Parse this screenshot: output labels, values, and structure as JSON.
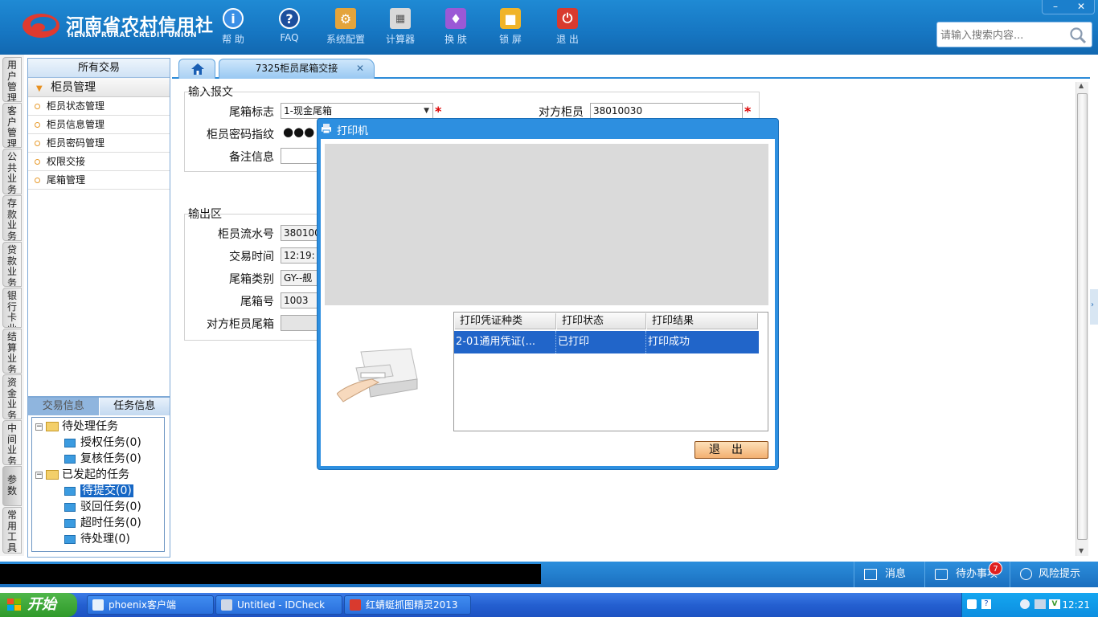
{
  "header": {
    "logo_cn": "河南省农村信用社",
    "logo_en": "HENAN RURAL CREDIT UNION",
    "toolbar": [
      {
        "label": "帮 助",
        "icon": "help-icon"
      },
      {
        "label": "FAQ",
        "icon": "faq-icon"
      },
      {
        "label": "系统配置",
        "icon": "settings-icon"
      },
      {
        "label": "计算器",
        "icon": "calculator-icon"
      },
      {
        "label": "换 肤",
        "icon": "skin-icon"
      },
      {
        "label": "锁 屏",
        "icon": "lock-icon"
      },
      {
        "label": "退 出",
        "icon": "power-icon"
      }
    ],
    "search_placeholder": "请输入搜索内容...",
    "win_minimize": "–",
    "win_close": "✕"
  },
  "vtabs": [
    "用户管理",
    "客户管理",
    "公共业务",
    "存款业务",
    "贷款业务",
    "银行卡业务",
    "结算业务",
    "资金业务",
    "中间业务",
    "参数",
    "常用工具"
  ],
  "left_panel": {
    "title": "所有交易",
    "group": "柜员管理",
    "items": [
      "柜员状态管理",
      "柜员信息管理",
      "柜员密码管理",
      "权限交接",
      "尾箱管理"
    ]
  },
  "task_panel": {
    "tab_trans": "交易信息",
    "tab_task": "任务信息",
    "pending": "待处理任务",
    "auth": "授权任务(0)",
    "review": "复核任务(0)",
    "initiated": "已发起的任务",
    "submitted": "待提交(0)",
    "rejected": "驳回任务(0)",
    "timeout": "超时任务(0)",
    "todo": "待处理(0)"
  },
  "tabs": {
    "active": "7325柜员尾箱交接",
    "close": "✕"
  },
  "input_section": {
    "title": "输入报文",
    "box_flag_label": "尾箱标志",
    "box_flag_value": "1-现金尾箱",
    "peer_teller_label": "对方柜员",
    "peer_teller_value": "38010030",
    "pwd_label": "柜员密码指纹",
    "pwd_value": "●●●",
    "remark_label": "备注信息",
    "required": "*"
  },
  "output_section": {
    "title": "输出区",
    "serial_label": "柜员流水号",
    "serial_value": "380100",
    "time_label": "交易时间",
    "time_value": "12:19:",
    "category_label": "尾箱类别",
    "category_value": "GY--舰",
    "box_no_label": "尾箱号",
    "box_no_value": "1003",
    "peer_box_label": "对方柜员尾箱"
  },
  "dialog": {
    "title": "打印机",
    "columns": [
      "打印凭证种类",
      "打印状态",
      "打印结果"
    ],
    "rows": [
      {
        "type": "2-01通用凭证(...",
        "status": "已打印",
        "result": "打印成功"
      }
    ],
    "exit_label": "退出"
  },
  "statusbar": {
    "message": "消息",
    "todo": "待办事项",
    "todo_count": "7",
    "risk": "风险提示"
  },
  "taskbar": {
    "start": "开始",
    "tasks": [
      "phoenix客户端",
      "Untitled - IDCheck",
      "红蜻蜓抓图精灵2013"
    ],
    "clock": "12:21"
  }
}
